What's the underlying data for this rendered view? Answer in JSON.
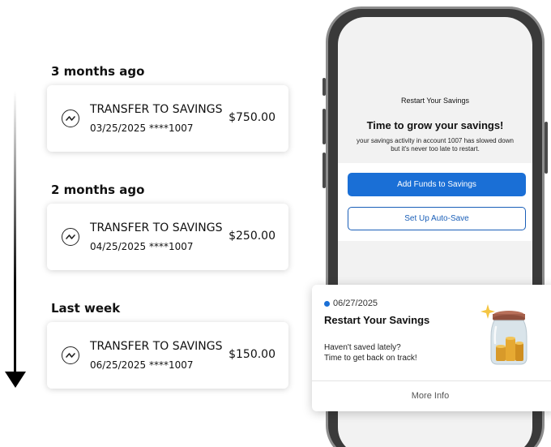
{
  "timeline": [
    {
      "label": "3 months ago",
      "transaction": {
        "title": "TRANSFER TO SAVINGS",
        "date": "03/25/2025",
        "account": "****1007",
        "amount": "$750.00"
      }
    },
    {
      "label": "2 months ago",
      "transaction": {
        "title": "TRANSFER TO SAVINGS",
        "date": "04/25/2025",
        "account": "****1007",
        "amount": "$250.00"
      }
    },
    {
      "label": "Last week",
      "transaction": {
        "title": "TRANSFER TO SAVINGS",
        "date": "06/25/2025",
        "account": "****1007",
        "amount": "$150.00"
      }
    }
  ],
  "phone": {
    "header": "Restart Your Savings",
    "headline": "Time to grow your savings!",
    "body_line1": "your savings activity in account 1007 has slowed down",
    "body_line2": "but it's never too late to restart.",
    "primary_button": "Add Funds to Savings",
    "secondary_button": "Set Up Auto-Save"
  },
  "notification": {
    "date": "06/27/2025",
    "title": "Restart Your Savings",
    "body_line1": "Haven't saved lately?",
    "body_line2": "Time to get back on track!",
    "link": "More Info",
    "image_icon": "savings-jar-icon"
  },
  "icons": {
    "transaction": "transfer-icon",
    "timeline": "timeline-arrow-icon"
  },
  "colors": {
    "accent": "#1a6fd6",
    "text": "#111111",
    "card_bg": "#ffffff"
  }
}
